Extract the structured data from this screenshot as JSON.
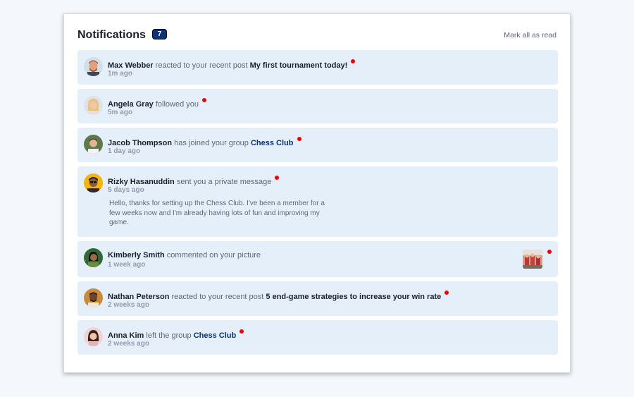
{
  "header": {
    "title": "Notifications",
    "count": "7",
    "mark_all": "Mark all as read"
  },
  "notifications": [
    {
      "name": "Max Webber",
      "action": "reacted to your recent post",
      "target": "My first tournament today!",
      "time": "1m ago"
    },
    {
      "name": "Angela Gray",
      "action": "followed you",
      "time": "5m ago"
    },
    {
      "name": "Jacob Thompson",
      "action": "has joined your group",
      "target": "Chess Club",
      "time": "1 day ago"
    },
    {
      "name": "Rizky Hasanuddin",
      "action": "sent you a private message",
      "time": "5 days ago",
      "message": "Hello, thanks for setting up the Chess Club. I've been a member for a few weeks now and I'm already having lots of fun and improving my game."
    },
    {
      "name": "Kimberly Smith",
      "action": "commented on your picture",
      "time": "1 week ago"
    },
    {
      "name": "Nathan Peterson",
      "action": "reacted to your recent post",
      "target": "5 end-game strategies to increase your win rate",
      "time": "2 weeks ago"
    },
    {
      "name": "Anna Kim",
      "action": "left the group",
      "target": "Chess Club",
      "time": "2 weeks ago"
    }
  ],
  "colors": {
    "unread_dot": "#f50000",
    "badge": "#0a327b",
    "unread_bg": "#e5effa",
    "group_link": "#0a327b"
  }
}
